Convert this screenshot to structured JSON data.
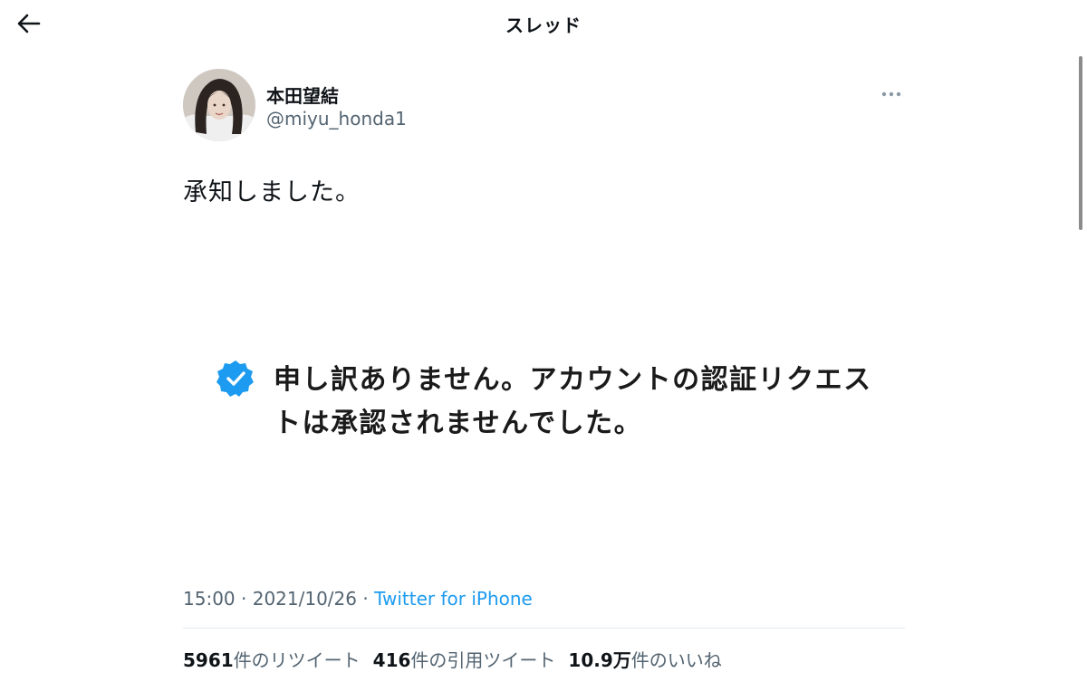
{
  "header": {
    "title": "スレッド",
    "back_icon": "arrow-left-icon"
  },
  "tweet": {
    "display_name": "本田望結",
    "handle": "@miyu_honda1",
    "more_icon": "more-horizontal-icon",
    "text": "承知しました。",
    "media": {
      "badge_icon": "verified-badge-icon",
      "badge_color": "#1d9bf0",
      "text": "申し訳ありません。アカウントの認証リクエストは承認されませんでした。"
    },
    "time": "15:00",
    "date": "2021/10/26",
    "separator": "·",
    "source": "Twitter for iPhone"
  },
  "stats": {
    "retweets_count": "5961",
    "retweets_label": "件のリツイート",
    "quotes_count": "416",
    "quotes_label": "件の引用ツイート",
    "likes_count": "10.9万",
    "likes_label": "件のいいね"
  },
  "colors": {
    "accent": "#1d9bf0",
    "secondary_text": "#536471",
    "primary_text": "#0f1419"
  }
}
